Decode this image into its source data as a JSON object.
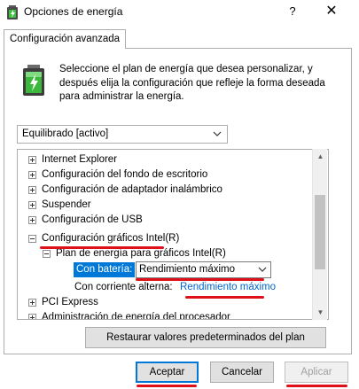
{
  "window": {
    "title": "Opciones de energía",
    "help_glyph": "?",
    "close_glyph": "✕"
  },
  "tab": {
    "label": "Configuración avanzada"
  },
  "intro": {
    "description": "Seleccione el plan de energía que desea personalizar, y después elija la configuración que refleje la forma deseada para administrar la energía."
  },
  "plan_dropdown": {
    "selected": "Equilibrado [activo]"
  },
  "tree": {
    "items": [
      {
        "label": "Internet Explorer",
        "state": "collapsed"
      },
      {
        "label": "Configuración del fondo de escritorio",
        "state": "collapsed"
      },
      {
        "label": "Configuración de adaptador inalámbrico",
        "state": "collapsed"
      },
      {
        "label": "Suspender",
        "state": "collapsed"
      },
      {
        "label": "Configuración de USB",
        "state": "collapsed"
      },
      {
        "label": "Configuración gráficos Intel(R)",
        "state": "expanded"
      },
      {
        "label": "Plan de energía para gráficos Intel(R)",
        "state": "expanded"
      },
      {
        "label": "PCI Express",
        "state": "collapsed"
      },
      {
        "label": "Administración de energía del procesador",
        "state": "collapsed"
      }
    ],
    "battery_label": "Con batería:",
    "battery_value": "Rendimiento máximo",
    "ac_label": "Con corriente alterna:",
    "ac_value": "Rendimiento máximo"
  },
  "buttons": {
    "restore": "Restaurar valores predeterminados del plan",
    "accept": "Aceptar",
    "cancel": "Cancelar",
    "apply": "Aplicar"
  },
  "colors": {
    "selection": "#0078d7",
    "annotation": "#e0101a",
    "link": "#0066cc"
  }
}
